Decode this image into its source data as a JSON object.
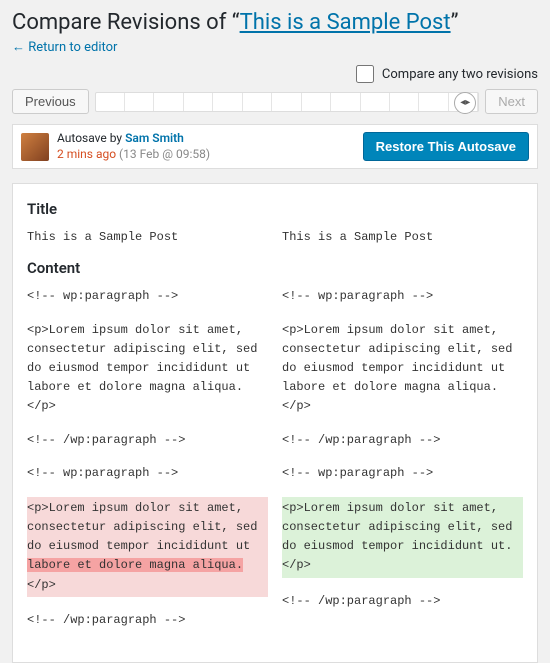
{
  "header": {
    "title_prefix": "Compare Revisions of “",
    "post_title": "This is a Sample Post",
    "title_suffix": "”",
    "return_link": "← Return to editor"
  },
  "controls": {
    "compare_label": "Compare any two revisions",
    "prev_label": "Previous",
    "next_label": "Next"
  },
  "meta": {
    "autosave_prefix": "Autosave by ",
    "user": "Sam Smith",
    "ago": "2 mins ago",
    "date": " (13 Feb @ 09:58)",
    "restore_label": "Restore This Autosave"
  },
  "diff": {
    "title_heading": "Title",
    "content_heading": "Content",
    "title_left": "This is a Sample Post",
    "title_right": "This is a Sample Post",
    "left": {
      "p1": "<!-- wp:paragraph -->",
      "p2": "<p>Lorem ipsum dolor sit amet, consectetur adipiscing elit, sed do eiusmod tempor incididunt ut labore et dolore magna aliqua. </p>",
      "p3": "<!-- /wp:paragraph -->",
      "p4": "<!-- wp:paragraph -->",
      "p5a": "<p>Lorem ipsum dolor sit amet, consectetur adipiscing elit, sed do eiusmod tempor incididunt ut",
      "p5b": " labore et dolore magna aliqua. ",
      "p5c": "</p>",
      "p6": "<!-- /wp:paragraph -->"
    },
    "right": {
      "p1": "<!-- wp:paragraph -->",
      "p2": "<p>Lorem ipsum dolor sit amet, consectetur adipiscing elit, sed do eiusmod tempor incididunt ut labore et dolore magna aliqua. </p>",
      "p3": "<!-- /wp:paragraph -->",
      "p4": "<!-- wp:paragraph -->",
      "p5": "<p>Lorem ipsum dolor sit amet, consectetur adipiscing elit, sed do eiusmod tempor incididunt ut.</p>",
      "p6": "<!-- /wp:paragraph -->"
    }
  }
}
